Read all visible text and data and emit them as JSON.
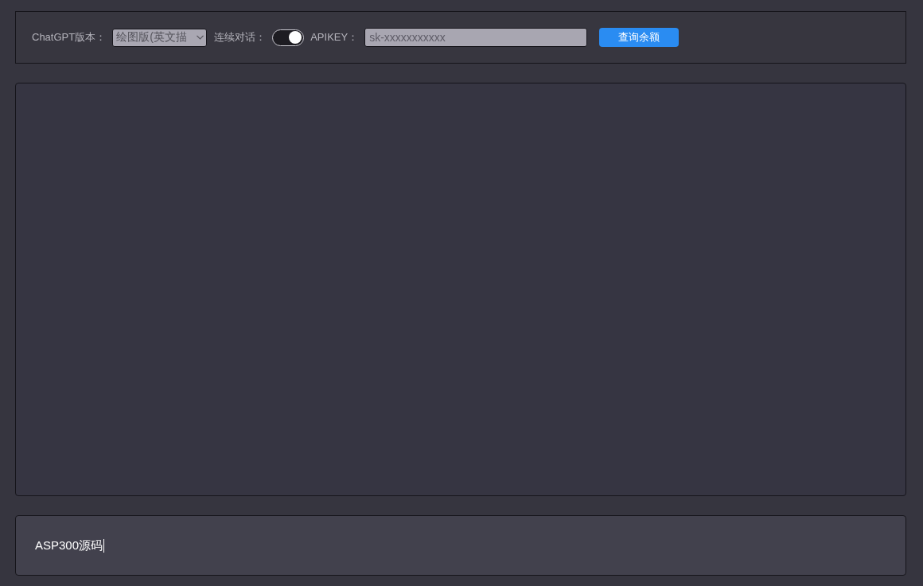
{
  "settings_bar": {
    "version": {
      "label": "ChatGPT版本：",
      "value": "绘图版(英文描"
    },
    "continuous_chat": {
      "label": "连续对话：",
      "on": true
    },
    "api_key": {
      "label": "APIKEY：",
      "placeholder": "sk-xxxxxxxxxxx"
    },
    "balance_button": "查询余额"
  },
  "message_input": {
    "value": "ASP300源码"
  }
}
